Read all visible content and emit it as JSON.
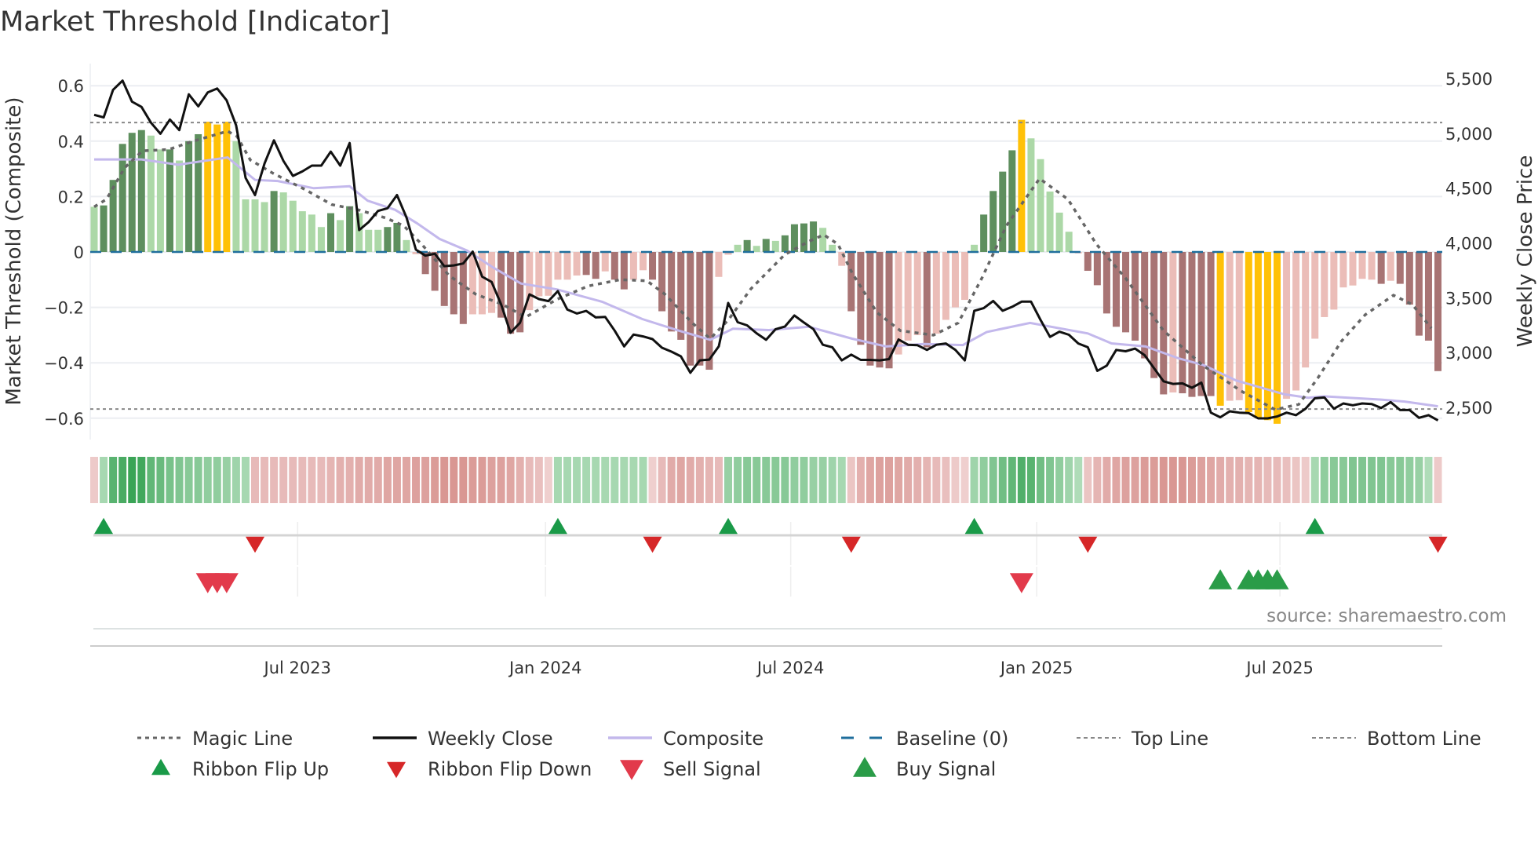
{
  "title": "Market Threshold [Indicator]",
  "source": "source: sharemaestro.com",
  "chart_data": {
    "type": "bar",
    "title": "Market Threshold [Indicator]",
    "ylabel": "Market Threshold (Composite)",
    "ylabel_right": "Weekly Close Price",
    "ylim": [
      -0.68,
      0.68
    ],
    "ylim_right": [
      2200,
      5600
    ],
    "yticks": [
      {
        "v": 0.6,
        "label": "0.6"
      },
      {
        "v": 0.4,
        "label": "0.4"
      },
      {
        "v": 0.2,
        "label": "0.2"
      },
      {
        "v": 0,
        "label": "0"
      },
      {
        "v": -0.2,
        "label": "−0.2"
      },
      {
        "v": -0.4,
        "label": "−0.4"
      },
      {
        "v": -0.6,
        "label": "−0.6"
      }
    ],
    "yticks_right": [
      {
        "v": 5500,
        "label": "5,500"
      },
      {
        "v": 5000,
        "label": "5,000"
      },
      {
        "v": 4500,
        "label": "4,500"
      },
      {
        "v": 4000,
        "label": "4,000"
      },
      {
        "v": 3500,
        "label": "3,500"
      },
      {
        "v": 3000,
        "label": "3,000"
      },
      {
        "v": 2500,
        "label": "2,500"
      }
    ],
    "xticks": [
      {
        "week": 21.5,
        "label": "Jul 2023"
      },
      {
        "week": 47.7,
        "label": "Jan 2024"
      },
      {
        "week": 73.6,
        "label": "Jul 2024"
      },
      {
        "week": 99.6,
        "label": "Jan 2025"
      },
      {
        "week": 125.3,
        "label": "Jul 2025"
      }
    ],
    "grid": true,
    "top_line": 0.467,
    "bottom_line": -0.567,
    "baseline": 0,
    "colors": {
      "strong_pos": "#5e8f5e",
      "weak_pos": "#acd8a7",
      "strong_neg": "#a87474",
      "weak_neg": "#ebbdb8",
      "extreme": "#ffc107",
      "weekly_close": "#111111",
      "composite": "#c3b8ec",
      "magic": "#666666",
      "baseline": "#1f6e9c",
      "flip_up": "#1a9a48",
      "flip_down": "#d62728",
      "sell": "#e23a4b",
      "buy": "#2a9c48"
    },
    "composite_bars": [
      0.163,
      0.168,
      0.26,
      0.39,
      0.43,
      0.44,
      0.42,
      0.37,
      0.37,
      0.33,
      0.4,
      0.425,
      0.47,
      0.46,
      0.47,
      0.4,
      0.19,
      0.19,
      0.18,
      0.22,
      0.215,
      0.185,
      0.147,
      0.135,
      0.09,
      0.14,
      0.115,
      0.165,
      0.14,
      0.08,
      0.08,
      0.09,
      0.105,
      0.043,
      -0.008,
      -0.08,
      -0.14,
      -0.195,
      -0.225,
      -0.26,
      -0.225,
      -0.225,
      -0.22,
      -0.237,
      -0.295,
      -0.29,
      -0.21,
      -0.16,
      -0.158,
      -0.1,
      -0.1,
      -0.085,
      -0.083,
      -0.097,
      -0.07,
      -0.1,
      -0.135,
      -0.1,
      -0.066,
      -0.1,
      -0.214,
      -0.287,
      -0.317,
      -0.41,
      -0.41,
      -0.425,
      -0.09,
      -0.01,
      0.026,
      0.043,
      0.022,
      0.047,
      0.04,
      0.06,
      0.1,
      0.103,
      0.11,
      0.087,
      0.026,
      -0.05,
      -0.214,
      -0.335,
      -0.41,
      -0.417,
      -0.42,
      -0.37,
      -0.32,
      -0.3,
      -0.344,
      -0.295,
      -0.245,
      -0.2,
      -0.173,
      0.026,
      0.135,
      0.22,
      0.29,
      0.367,
      0.477,
      0.41,
      0.335,
      0.218,
      0.142,
      0.073,
      -0.005,
      -0.068,
      -0.12,
      -0.222,
      -0.27,
      -0.29,
      -0.32,
      -0.384,
      -0.455,
      -0.514,
      -0.507,
      -0.51,
      -0.523,
      -0.52,
      -0.52,
      -0.555,
      -0.537,
      -0.535,
      -0.578,
      -0.6,
      -0.607,
      -0.62,
      -0.53,
      -0.5,
      -0.417,
      -0.313,
      -0.235,
      -0.208,
      -0.128,
      -0.121,
      -0.097,
      -0.1,
      -0.115,
      -0.104,
      -0.115,
      -0.19,
      -0.302,
      -0.32,
      -0.43
    ],
    "bar_kinds": "gGGGGGggGgGGYYYggggGgggggGgGgggGGgrRRRRRrrrRRRrrrrrrRRrRRrrRRRRRRRrrgGgGgGGGGggrRRRRRrrrRrrrrgGGGGYgggggrRRRRRRRRRrRRRRYrrYYYYrrrrrrrrrrRrRRRRR",
    "weekly_close": [
      5168,
      5144,
      5396,
      5480,
      5288,
      5240,
      5096,
      4995,
      5125,
      5029,
      5355,
      5245,
      5372,
      5408,
      5300,
      5072,
      4592,
      4436,
      4724,
      4935,
      4748,
      4611,
      4652,
      4705,
      4705,
      4832,
      4705,
      4911,
      4117,
      4189,
      4292,
      4316,
      4436,
      4232,
      3939,
      3884,
      3901,
      3788,
      3795,
      3812,
      3920,
      3692,
      3644,
      3440,
      3181,
      3272,
      3531,
      3488,
      3469,
      3560,
      3392,
      3356,
      3380,
      3320,
      3325,
      3200,
      3056,
      3164,
      3147,
      3123,
      3044,
      3008,
      2965,
      2816,
      2929,
      2936,
      3056,
      3452,
      3277,
      3248,
      3176,
      3116,
      3212,
      3238,
      3338,
      3274,
      3214,
      3071,
      3048,
      2929,
      2981,
      2933,
      2933,
      2929,
      2940,
      3119,
      3071,
      3067,
      3024,
      3071,
      3083,
      3024,
      2929,
      3381,
      3405,
      3471,
      3381,
      3417,
      3464,
      3464,
      3298,
      3143,
      3190,
      3162,
      3083,
      3048,
      2833,
      2881,
      3024,
      3012,
      3036,
      2976,
      2857,
      2738,
      2714,
      2719,
      2679,
      2726,
      2452,
      2410,
      2464,
      2452,
      2448,
      2400,
      2400,
      2417,
      2452,
      2429,
      2488,
      2583,
      2590,
      2488,
      2536,
      2519,
      2536,
      2531,
      2495,
      2548,
      2476,
      2476,
      2405,
      2429,
      2381
    ],
    "composite_line": [
      [
        0,
        0.334
      ],
      [
        5,
        0.334
      ],
      [
        8.9,
        0.315
      ],
      [
        14.1,
        0.341
      ],
      [
        17,
        0.26
      ],
      [
        19.4,
        0.256
      ],
      [
        23.2,
        0.23
      ],
      [
        27,
        0.237
      ],
      [
        28.9,
        0.185
      ],
      [
        31.8,
        0.152
      ],
      [
        34.1,
        0.104
      ],
      [
        36.5,
        0.047
      ],
      [
        39.4,
        0.005
      ],
      [
        42.2,
        -0.057
      ],
      [
        45.1,
        -0.114
      ],
      [
        48.9,
        -0.135
      ],
      [
        53.7,
        -0.18
      ],
      [
        57.9,
        -0.242
      ],
      [
        61.8,
        -0.284
      ],
      [
        65.1,
        -0.317
      ],
      [
        67.5,
        -0.277
      ],
      [
        71.3,
        -0.282
      ],
      [
        73,
        -0.277
      ],
      [
        75.5,
        -0.27
      ],
      [
        80.1,
        -0.313
      ],
      [
        83.7,
        -0.341
      ],
      [
        87.7,
        -0.332
      ],
      [
        91.8,
        -0.336
      ],
      [
        94.3,
        -0.289
      ],
      [
        98.9,
        -0.256
      ],
      [
        105,
        -0.294
      ],
      [
        107.5,
        -0.33
      ],
      [
        111.1,
        -0.341
      ],
      [
        114.6,
        -0.384
      ],
      [
        117.2,
        -0.408
      ],
      [
        120.7,
        -0.464
      ],
      [
        125.8,
        -0.514
      ],
      [
        128.3,
        -0.526
      ],
      [
        129.9,
        -0.521
      ],
      [
        136,
        -0.533
      ],
      [
        138.5,
        -0.54
      ],
      [
        142,
        -0.557
      ]
    ],
    "magic_line": [
      [
        0,
        0.163
      ],
      [
        1.3,
        0.19
      ],
      [
        3.2,
        0.303
      ],
      [
        5.1,
        0.365
      ],
      [
        7.9,
        0.37
      ],
      [
        10.3,
        0.398
      ],
      [
        14.1,
        0.436
      ],
      [
        15.1,
        0.417
      ],
      [
        16.5,
        0.332
      ],
      [
        18.9,
        0.284
      ],
      [
        22.2,
        0.227
      ],
      [
        25.1,
        0.171
      ],
      [
        27.9,
        0.152
      ],
      [
        30.8,
        0.123
      ],
      [
        32.7,
        0.095
      ],
      [
        34.6,
        0.028
      ],
      [
        37.5,
        -0.085
      ],
      [
        40.3,
        -0.152
      ],
      [
        43.2,
        -0.19
      ],
      [
        45.6,
        -0.235
      ],
      [
        48.9,
        -0.171
      ],
      [
        52.2,
        -0.123
      ],
      [
        55.6,
        -0.1
      ],
      [
        58.4,
        -0.104
      ],
      [
        60.3,
        -0.152
      ],
      [
        63.2,
        -0.256
      ],
      [
        65.1,
        -0.313
      ],
      [
        67,
        -0.246
      ],
      [
        69.4,
        -0.133
      ],
      [
        72.7,
        -0.019
      ],
      [
        73,
        -0.009
      ],
      [
        75.5,
        0.038
      ],
      [
        77.1,
        0.062
      ],
      [
        78.6,
        0.028
      ],
      [
        80.1,
        -0.076
      ],
      [
        82.7,
        -0.218
      ],
      [
        85.2,
        -0.284
      ],
      [
        88.7,
        -0.3
      ],
      [
        91.3,
        -0.256
      ],
      [
        93.8,
        -0.095
      ],
      [
        96.4,
        0.095
      ],
      [
        99.9,
        0.265
      ],
      [
        102.9,
        0.19
      ],
      [
        105.9,
        0.028
      ],
      [
        109,
        -0.095
      ],
      [
        113,
        -0.284
      ],
      [
        117.1,
        -0.408
      ],
      [
        121.2,
        -0.502
      ],
      [
        124.8,
        -0.569
      ],
      [
        127.3,
        -0.55
      ],
      [
        129.3,
        -0.455
      ],
      [
        131.8,
        -0.322
      ],
      [
        134.3,
        -0.227
      ],
      [
        137.3,
        -0.156
      ],
      [
        139.3,
        -0.19
      ],
      [
        141.3,
        -0.275
      ]
    ],
    "ribbon": [
      -0.2,
      0.3,
      0.8,
      0.9,
      1.0,
      0.95,
      0.75,
      0.7,
      0.6,
      0.55,
      0.5,
      0.5,
      0.45,
      0.45,
      0.4,
      0.35,
      0.3,
      -0.35,
      -0.35,
      -0.35,
      -0.35,
      -0.35,
      -0.35,
      -0.35,
      -0.35,
      -0.4,
      -0.45,
      -0.45,
      -0.5,
      -0.5,
      -0.5,
      -0.55,
      -0.55,
      -0.55,
      -0.6,
      -0.6,
      -0.65,
      -0.7,
      -0.7,
      -0.7,
      -0.65,
      -0.65,
      -0.6,
      -0.6,
      -0.55,
      -0.45,
      -0.35,
      -0.3,
      -0.15,
      0.3,
      0.3,
      0.3,
      0.3,
      0.3,
      0.3,
      0.3,
      0.3,
      0.3,
      0.3,
      -0.15,
      -0.35,
      -0.5,
      -0.55,
      -0.5,
      -0.45,
      -0.4,
      -0.35,
      0.4,
      0.45,
      0.5,
      0.5,
      0.5,
      0.5,
      0.5,
      0.45,
      0.45,
      0.4,
      0.4,
      0.35,
      0.3,
      -0.25,
      -0.45,
      -0.55,
      -0.6,
      -0.6,
      -0.55,
      -0.5,
      -0.45,
      -0.4,
      -0.35,
      -0.3,
      -0.2,
      -0.15,
      0.35,
      0.45,
      0.55,
      0.65,
      0.75,
      0.85,
      0.8,
      0.65,
      0.55,
      0.45,
      0.35,
      0.25,
      -0.25,
      -0.4,
      -0.5,
      -0.55,
      -0.6,
      -0.6,
      -0.65,
      -0.65,
      -0.7,
      -0.7,
      -0.7,
      -0.65,
      -0.6,
      -0.55,
      -0.5,
      -0.45,
      -0.45,
      -0.4,
      -0.4,
      -0.35,
      -0.35,
      -0.3,
      -0.25,
      -0.2,
      0.3,
      0.45,
      0.5,
      0.5,
      0.55,
      0.55,
      0.55,
      0.55,
      0.5,
      0.5,
      0.45,
      0.4,
      0.25,
      -0.2
    ],
    "ribbon_flip_up": [
      1,
      49,
      67,
      93,
      129
    ],
    "ribbon_flip_down": [
      17,
      59,
      80,
      105,
      142
    ],
    "sell_signals": [
      12,
      13,
      14,
      98
    ],
    "buy_signals": [
      119,
      122,
      123,
      124,
      125
    ],
    "legend": [
      {
        "label": "Magic Line",
        "kind": "dotted"
      },
      {
        "label": "Weekly Close",
        "kind": "solid"
      },
      {
        "label": "Composite",
        "kind": "lavender"
      },
      {
        "label": "Baseline (0)",
        "kind": "dashed"
      },
      {
        "label": "Top Line",
        "kind": "fine-dash"
      },
      {
        "label": "Bottom Line",
        "kind": "fine-dash"
      },
      {
        "label": "Ribbon Flip Up",
        "kind": "tri-up-small"
      },
      {
        "label": "Ribbon Flip Down",
        "kind": "tri-down-small"
      },
      {
        "label": "Sell Signal",
        "kind": "tri-down-big"
      },
      {
        "label": "Buy Signal",
        "kind": "tri-up-big"
      }
    ],
    "legend_placement": "bottom"
  }
}
